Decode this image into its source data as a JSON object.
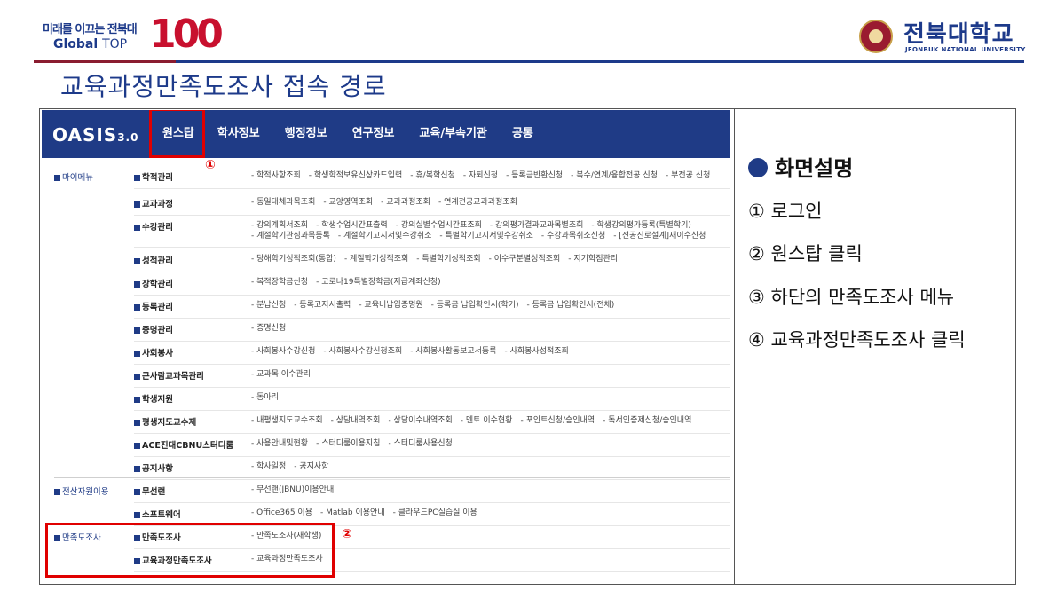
{
  "header": {
    "logo_left_line1": "미래를 이끄는 전북대",
    "logo_left_global": "Global",
    "logo_left_top": "TOP",
    "logo_left_number": "100",
    "univ_name_ko": "전북대학교",
    "univ_name_en": "JEONBUK NATIONAL UNIVERSITY"
  },
  "page_title": "교육과정만족도조사 접속 경로",
  "screen": {
    "brand": "OASIS",
    "brand_version": "3.0",
    "nav": [
      "원스탑",
      "학사정보",
      "행정정보",
      "연구정보",
      "교육/부속기관",
      "공통"
    ],
    "callout_1": "①",
    "callout_2": "②",
    "groups": [
      {
        "name": "마이메뉴",
        "rows": [
          {
            "sub": "학적관리",
            "items": [
              "학적사항조회",
              "학생학적보유신상카드입력",
              "휴/복학신청",
              "자퇴신청",
              "등록금반환신청",
              "복수/연계/융합전공 신청",
              "부전공 신청"
            ]
          },
          {
            "sub": "교과과정",
            "items": [
              "동일대체과목조회",
              "교양영역조회",
              "교과과정조회",
              "연계전공교과과정조회"
            ]
          },
          {
            "sub": "수강관리",
            "items": [
              "강의계획서조회",
              "학생수업시간표출력",
              "강의실별수업시간표조회",
              "강의평가결과교과목별조회",
              "학생강의평가등록(특별학기)"
            ],
            "items2": [
              "계절학기관심과목등록",
              "계절학기고지서및수강취소",
              "특별학기고지서및수강취소",
              "수강과목취소신청",
              "[전공진로설계]재이수신청"
            ]
          },
          {
            "sub": "성적관리",
            "items": [
              "당해학기성적조회(통합)",
              "계절학기성적조회",
              "특별학기성적조회",
              "이수구분별성적조회",
              "지기학점관리"
            ]
          },
          {
            "sub": "장학관리",
            "items": [
              "복적장학금신청",
              "코로나19특별장학금(지급계좌신청)"
            ]
          },
          {
            "sub": "등록관리",
            "items": [
              "분납신청",
              "등록고지서출력",
              "교육비납입증명원",
              "등록금 납입확인서(학기)",
              "등록금 납입확인서(전체)"
            ]
          },
          {
            "sub": "증명관리",
            "items": [
              "증명신청"
            ]
          },
          {
            "sub": "사회봉사",
            "items": [
              "사회봉사수강신청",
              "사회봉사수강신청조회",
              "사회봉사활동보고서등록",
              "사회봉사성적조회"
            ]
          },
          {
            "sub": "큰사람교과목관리",
            "items": [
              "교과목 이수관리"
            ]
          },
          {
            "sub": "학생지원",
            "items": [
              "동아리"
            ]
          },
          {
            "sub": "평생지도교수제",
            "items": [
              "내평생지도교수조회",
              "상담내역조회",
              "상담이수내역조회",
              "멘토 이수현황",
              "포인트신청/승인내역",
              "독서인증제신청/승인내역"
            ]
          },
          {
            "sub": "ACE진대CBNU스터디룸",
            "items": [
              "사용안내및현황",
              "스터디룸이용지침",
              "스터디룸사용신청"
            ]
          },
          {
            "sub": "공지사항",
            "items": [
              "학사일정",
              "공지사항"
            ]
          }
        ]
      },
      {
        "name": "전산자원이용",
        "rows": [
          {
            "sub": "무선랜",
            "items": [
              "무선랜(JBNU)이용안내"
            ]
          },
          {
            "sub": "소프트웨어",
            "items": [
              "Office365 이용",
              "Matlab 이용안내",
              "클라우드PC실습실 이용"
            ]
          }
        ]
      },
      {
        "name": "만족도조사",
        "rows": [
          {
            "sub": "만족도조사",
            "items": [
              "만족도조사(재학생)"
            ]
          },
          {
            "sub": "교육과정만족도조사",
            "items": [
              "교육과정만족도조사"
            ]
          }
        ]
      }
    ]
  },
  "description": {
    "heading": "화면설명",
    "steps": [
      "① 로그인",
      "② 원스탑 클릭",
      "③ 하단의 만족도조사 메뉴",
      "④ 교육과정만족도조사 클릭"
    ]
  },
  "colors": {
    "navy": "#1f3b86",
    "highlight_red": "#e00000",
    "brand_red": "#c8102e"
  }
}
